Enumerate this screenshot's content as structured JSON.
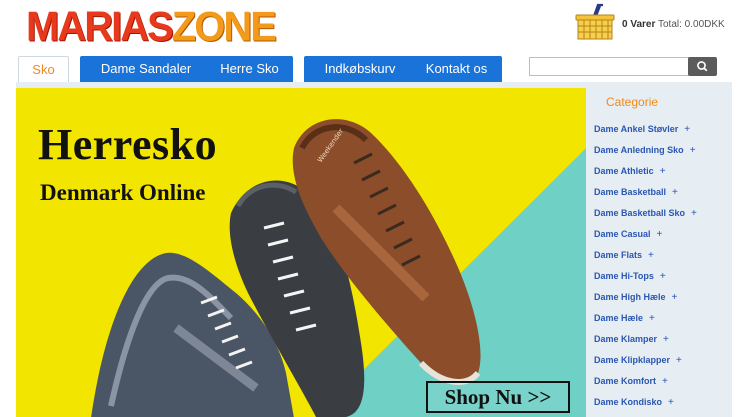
{
  "header": {
    "logo_part1": "MARIAS",
    "logo_part2": "ZONE",
    "cart_count": "0 Varer",
    "cart_total": "Total: 0.00DKK"
  },
  "nav": {
    "tabs": [
      {
        "label": "Sko",
        "active": true
      },
      {
        "label": "Dame Sandaler",
        "active": false
      },
      {
        "label": "Herre Sko",
        "active": false
      },
      {
        "label": "Indkøbskurv",
        "active": false
      },
      {
        "label": "Kontakt os",
        "active": false
      }
    ],
    "search": {
      "value": "",
      "placeholder": ""
    },
    "search_icon": "search-icon"
  },
  "banner": {
    "title": "Herresko",
    "subtitle": "Denmark Online",
    "cta": "Shop Nu >>",
    "shoe_brand": "Weekender"
  },
  "sidebar": {
    "heading": "Categorie",
    "expand_symbol": "+",
    "categories": [
      "Dame Ankel Støvler",
      "Dame Anledning Sko",
      "Dame Athletic",
      "Dame Basketball",
      "Dame Basketball Sko",
      "Dame Casual",
      "Dame Flats",
      "Dame Hi-Tops",
      "Dame High Hæle",
      "Dame Hæle",
      "Dame Klamper",
      "Dame Klipklapper",
      "Dame Komfort",
      "Dame Kondisko"
    ]
  },
  "colors": {
    "brand_red": "#e8391d",
    "brand_orange": "#f39a1b",
    "nav_blue": "#1a73d9",
    "banner_yellow": "#f2e500",
    "banner_teal": "#6fd0c6",
    "link_blue": "#2a57b2"
  }
}
